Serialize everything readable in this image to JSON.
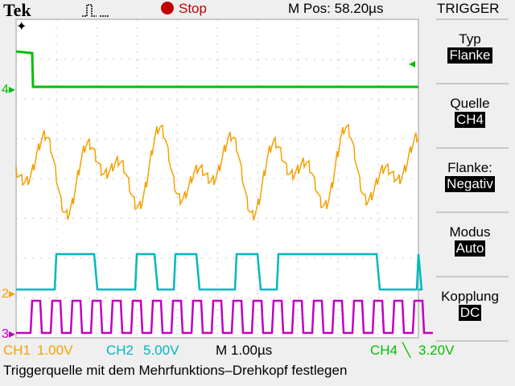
{
  "header": {
    "brand": "Tek",
    "acquire_icon": "pulse-icon",
    "run_state": "Stop",
    "m_pos": "M Pos: 58.20µs",
    "menu_title": "TRIGGER"
  },
  "menu": [
    {
      "label": "Typ",
      "value": "Flanke"
    },
    {
      "label": "Quelle",
      "value": "CH4"
    },
    {
      "label": "Flanke:",
      "value": "Negativ"
    },
    {
      "label": "Modus",
      "value": "Auto"
    },
    {
      "label": "Kopplung",
      "value": "DC"
    }
  ],
  "channels": {
    "ch1": {
      "name": "CH1",
      "scale": "1.00V",
      "color": "#f5a000"
    },
    "ch2": {
      "name": "CH2",
      "scale": "5.00V",
      "color": "#00b8c0"
    },
    "ch3": {
      "marker": "3",
      "color": "#c000c0"
    },
    "ch4": {
      "name": "CH4",
      "marker": "4",
      "color": "#00c000",
      "trigger_level": "3.20V"
    },
    "ch2_marker": "2"
  },
  "timebase": "M 1.00µs",
  "message": "Triggerquelle mit dem Mehrfunktions–Drehkopf festlegen"
}
